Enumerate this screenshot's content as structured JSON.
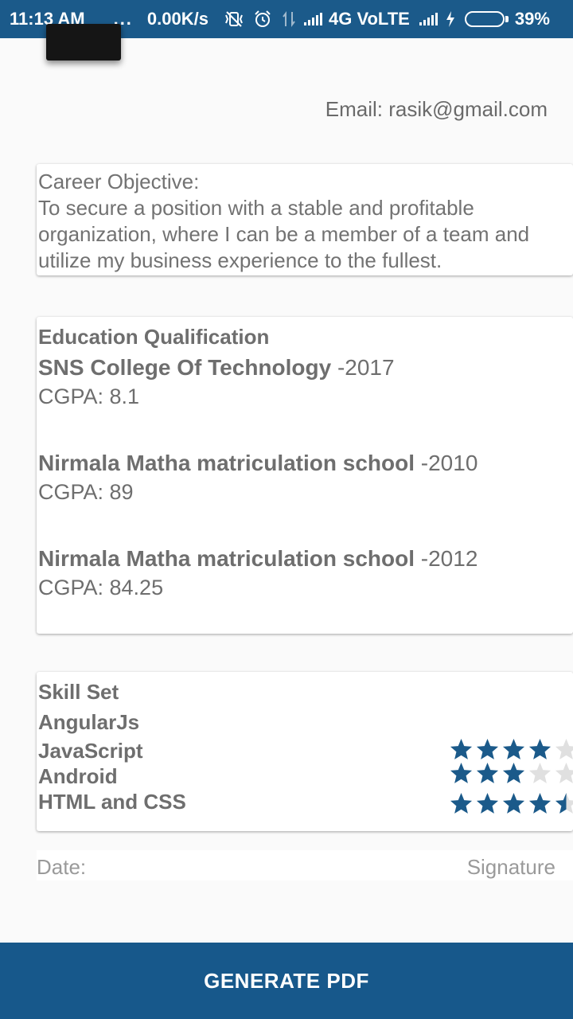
{
  "status_bar": {
    "time": "11:13 AM",
    "dots": "...",
    "speed": "0.00K/s",
    "network": "4G VoLTE",
    "battery": "39%",
    "battery_level": 0.39
  },
  "profile": {
    "email": "Email: rasik@gmail.com"
  },
  "objective": {
    "title": "Career Objective:",
    "text": " To secure a position with a stable and profitable organization, where I can be a member of a team and utilize my business experience to the fullest."
  },
  "education": {
    "title": "Education Qualification",
    "items": [
      {
        "institution": "SNS College Of Technology",
        "year": " -2017",
        "gpa": "CGPA: 8.1"
      },
      {
        "institution": "Nirmala Matha matriculation school",
        "year": " -2010",
        "gpa": "CGPA: 89"
      },
      {
        "institution": "Nirmala Matha matriculation school",
        "year": " -2012",
        "gpa": "CGPA: 84.25"
      }
    ]
  },
  "skills": {
    "title": "Skill Set",
    "items": [
      {
        "name": "AngularJs",
        "rating": null
      },
      {
        "name": "JavaScript",
        "rating": 4
      },
      {
        "name": "Android",
        "rating": 3
      },
      {
        "name": "HTML and CSS",
        "rating": 4.5
      }
    ],
    "star_color": "#1b5a8a",
    "star_empty_color": "#e0e0e0"
  },
  "footer": {
    "date_label": "Date:",
    "signature_label": "Signature"
  },
  "actions": {
    "generate_label": "GENERATE PDF"
  }
}
